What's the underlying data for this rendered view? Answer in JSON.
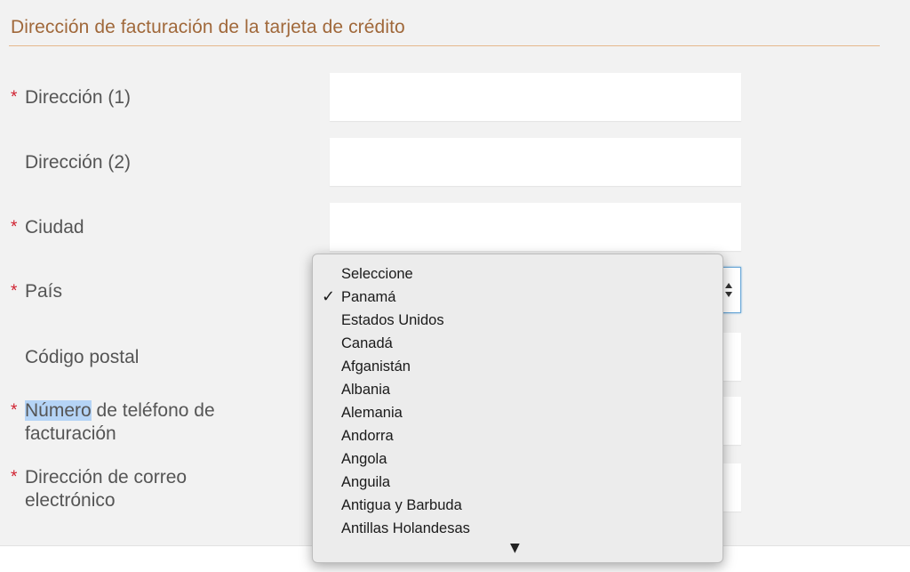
{
  "section": {
    "title": "Dirección de facturación de la tarjeta de crédito"
  },
  "colors": {
    "section_title": "#a0683a",
    "required_asterisk": "#d0202f",
    "focus_border": "#6aa8d8",
    "text_highlight": "#b5d4f6"
  },
  "fields": {
    "address1": {
      "label": "Dirección (1)",
      "required_mark": "*",
      "value": ""
    },
    "address2": {
      "label": "Dirección (2)",
      "value": ""
    },
    "city": {
      "label": "Ciudad",
      "required_mark": "*",
      "value": ""
    },
    "country": {
      "label": "País",
      "required_mark": "*",
      "selected": "Panamá"
    },
    "postal_code": {
      "label": "Código postal",
      "value": ""
    },
    "phone": {
      "label_highlighted": "Número",
      "label_rest": " de teléfono de",
      "label_line2": "facturación",
      "required_mark": "*",
      "value": ""
    },
    "email": {
      "label_line1": "Dirección de correo",
      "label_line2": "electrónico",
      "required_mark": "*",
      "value": ""
    }
  },
  "country_dropdown": {
    "check_glyph": "✓",
    "scroll_down_glyph": "▼",
    "options": [
      "Seleccione",
      "Panamá",
      "Estados Unidos",
      "Canadá",
      "Afganistán",
      "Albania",
      "Alemania",
      "Andorra",
      "Angola",
      "Anguila",
      "Antigua y Barbuda",
      "Antillas Holandesas"
    ],
    "selected_index": 1
  }
}
